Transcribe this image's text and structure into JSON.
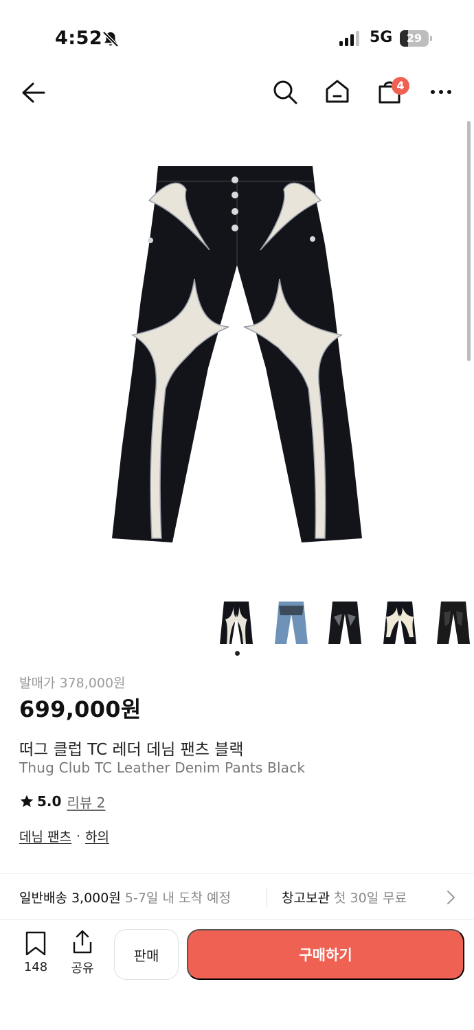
{
  "status_bar": {
    "time": "4:52",
    "network": "5G",
    "battery": "29",
    "battery_level": 0.29
  },
  "nav": {
    "cart_count": "4",
    "icons": [
      "back-icon",
      "search-icon",
      "home-icon",
      "cart-icon",
      "more-icon"
    ]
  },
  "product": {
    "image_icon": "denim-pants-image",
    "thumbnails": [
      "black-cream-pants",
      "blue-denim-pants",
      "black-gray-pants",
      "black-ivory-pants",
      "black-leather-pants"
    ],
    "selected_thumbnail_index": 0,
    "release_price": "발매가 378,000원",
    "price": "699,000원",
    "title_ko": "떠그 클럽 TC 레더 데님 팬츠 블랙",
    "title_en": "Thug Club TC Leather Denim Pants Black",
    "rating": "5.0",
    "review_link": "리뷰 2",
    "category": "데님 팬츠",
    "category_separator": "·",
    "subcategory": "하의"
  },
  "delivery": {
    "shipping_label": "일반배송 3,000원",
    "shipping_eta": "5-7일 내 도착 예정",
    "storage_label": "창고보관",
    "storage_note": "첫 30일 무료"
  },
  "bottom_bar": {
    "bookmark_count": "148",
    "share_label": "공유",
    "sell_label": "판매",
    "buy_label": "구매하기"
  },
  "colors": {
    "accent": "#ef6253",
    "muted_text": "#8a8a8a",
    "pants_black": "#121419",
    "pants_cream": "#e8e4d9"
  }
}
